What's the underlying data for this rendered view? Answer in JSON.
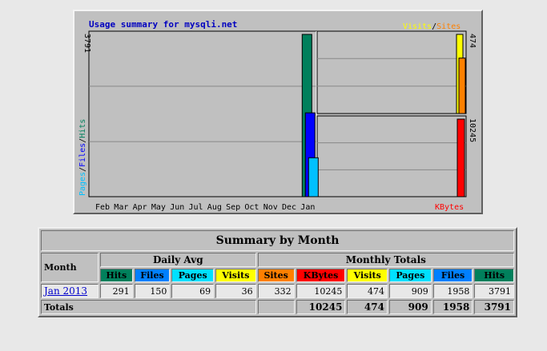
{
  "graph": {
    "title": "Usage summary for mysqli.net",
    "legend_visits": "Visits",
    "legend_sep": "/",
    "legend_sites": "Sites",
    "legend_kbytes": "KBytes",
    "legend_pages": "Pages",
    "legend_files": "Files",
    "legend_hits": "Hits",
    "max_hits_label": "3791",
    "max_visits_label": "474",
    "max_kbytes_label": "10245",
    "months": [
      "Feb",
      "Mar",
      "Apr",
      "May",
      "Jun",
      "Jul",
      "Aug",
      "Sep",
      "Oct",
      "Nov",
      "Dec",
      "Jan"
    ],
    "colors": {
      "hits": "#00805c",
      "files": "#0000ff",
      "pages": "#00c0ff",
      "visits": "#ffff00",
      "sites": "#ff8000",
      "kbytes": "#ff0000",
      "title": "#0000c0"
    }
  },
  "chart_data": {
    "type": "bar",
    "categories": [
      "Feb",
      "Mar",
      "Apr",
      "May",
      "Jun",
      "Jul",
      "Aug",
      "Sep",
      "Oct",
      "Nov",
      "Dec",
      "Jan"
    ],
    "series": [
      {
        "name": "Hits",
        "values": [
          0,
          0,
          0,
          0,
          0,
          0,
          0,
          0,
          0,
          0,
          0,
          3791
        ]
      },
      {
        "name": "Files",
        "values": [
          0,
          0,
          0,
          0,
          0,
          0,
          0,
          0,
          0,
          0,
          0,
          1958
        ]
      },
      {
        "name": "Pages",
        "values": [
          0,
          0,
          0,
          0,
          0,
          0,
          0,
          0,
          0,
          0,
          0,
          909
        ]
      },
      {
        "name": "Visits",
        "values": [
          0,
          0,
          0,
          0,
          0,
          0,
          0,
          0,
          0,
          0,
          0,
          474
        ]
      },
      {
        "name": "Sites",
        "values": [
          0,
          0,
          0,
          0,
          0,
          0,
          0,
          0,
          0,
          0,
          0,
          332
        ]
      },
      {
        "name": "KBytes",
        "values": [
          0,
          0,
          0,
          0,
          0,
          0,
          0,
          0,
          0,
          0,
          0,
          10245
        ]
      }
    ],
    "title": "Usage summary for mysqli.net",
    "ylim_hits": [
      0,
      3791
    ],
    "ylim_visits": [
      0,
      474
    ],
    "ylim_kbytes": [
      0,
      10245
    ]
  },
  "summary": {
    "title": "Summary by Month",
    "month_label": "Month",
    "daily_avg_label": "Daily Avg",
    "monthly_totals_label": "Monthly Totals",
    "daily_headers": [
      {
        "label": "Hits",
        "color": "#00805c",
        "text": "#000000"
      },
      {
        "label": "Files",
        "color": "#0080ff",
        "text": "#000000"
      },
      {
        "label": "Pages",
        "color": "#00e0ff",
        "text": "#000000"
      },
      {
        "label": "Visits",
        "color": "#ffff00",
        "text": "#000000"
      }
    ],
    "monthly_headers": [
      {
        "label": "Sites",
        "color": "#ff8000",
        "text": "#000000"
      },
      {
        "label": "KBytes",
        "color": "#ff0000",
        "text": "#000000"
      },
      {
        "label": "Visits",
        "color": "#ffff00",
        "text": "#000000"
      },
      {
        "label": "Pages",
        "color": "#00e0ff",
        "text": "#000000"
      },
      {
        "label": "Files",
        "color": "#0080ff",
        "text": "#000000"
      },
      {
        "label": "Hits",
        "color": "#00805c",
        "text": "#000000"
      }
    ],
    "row": {
      "month": "Jan 2013",
      "values": [
        "291",
        "150",
        "69",
        "36",
        "332",
        "10245",
        "474",
        "909",
        "1958",
        "3791"
      ]
    },
    "totals_label": "Totals",
    "totals": [
      "10245",
      "474",
      "909",
      "1958",
      "3791"
    ]
  }
}
